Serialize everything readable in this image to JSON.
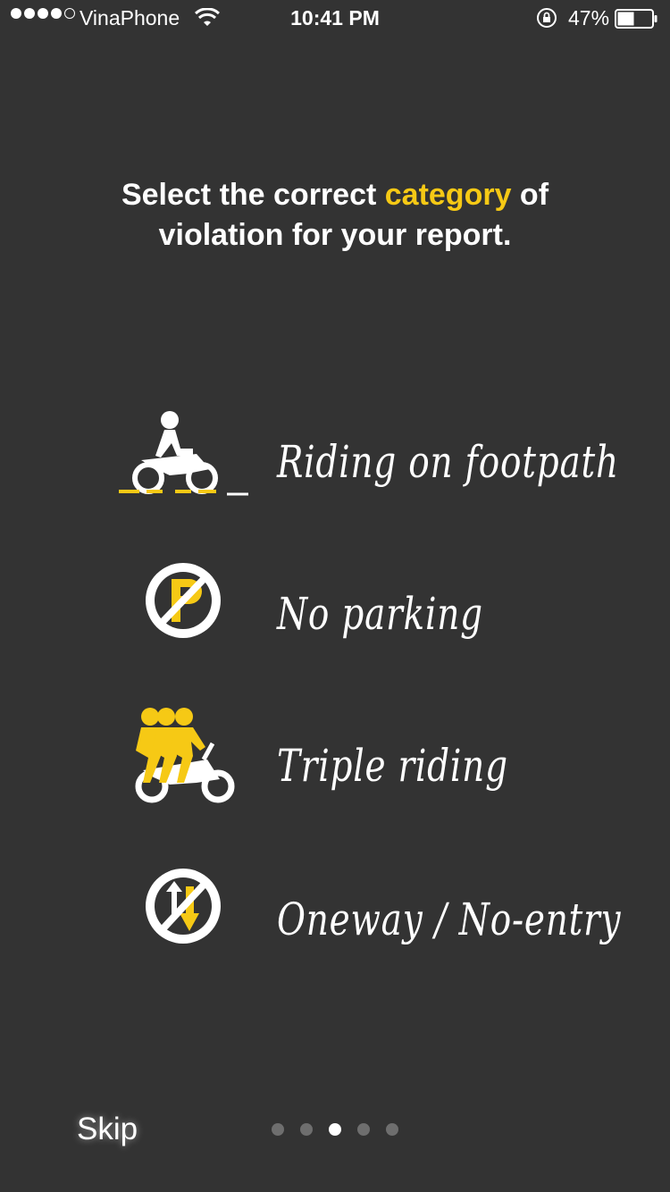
{
  "status_bar": {
    "carrier": "VinaPhone",
    "time": "10:41 PM",
    "battery_percent": "47%",
    "signal_bars_filled": 4,
    "signal_bars_total": 5,
    "battery_level": 0.47
  },
  "headline": {
    "part1": "Select the correct ",
    "accent": "category",
    "part2": " of",
    "line2": "violation for your report."
  },
  "categories": [
    {
      "label": "Riding on footpath",
      "icon": "motorbike-footpath-icon"
    },
    {
      "label": "No parking",
      "icon": "no-parking-icon"
    },
    {
      "label": "Triple riding",
      "icon": "triple-riding-icon"
    },
    {
      "label": "Oneway / No-entry",
      "icon": "no-entry-icon"
    }
  ],
  "footer": {
    "skip_label": "Skip",
    "page_count": 5,
    "active_page": 3
  },
  "colors": {
    "background": "#333333",
    "accent": "#f6c915",
    "text": "#ffffff"
  }
}
